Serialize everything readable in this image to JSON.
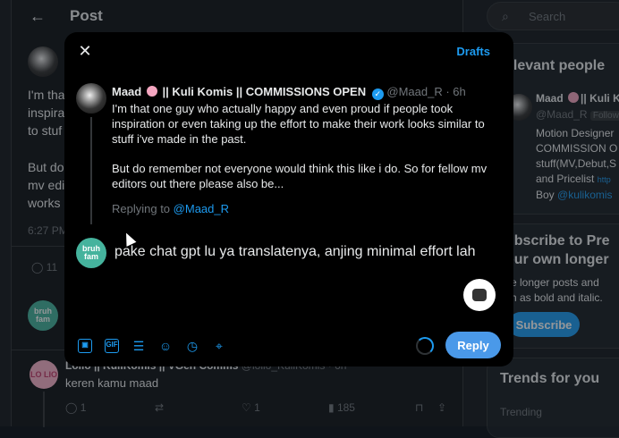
{
  "header": {
    "title": "Post"
  },
  "background_post": {
    "text_lines": [
      "I'm tha",
      "inspira",
      "to stuf",
      "",
      "But do",
      "mv edi",
      "works"
    ],
    "time": "6:27 PM",
    "reply_count": "11"
  },
  "background_reply": {
    "name": "Lolio || KuliKomis || VGen Comms",
    "handle": "@lolio_KuliKomis",
    "time": "6h",
    "text": "keren kamu maad",
    "replies": "1",
    "likes": "1",
    "views": "185",
    "avatar_text": "LO LIO"
  },
  "right_sidebar": {
    "search_placeholder": "Search",
    "relevant_title": "elevant people",
    "relevant_name": "Maad",
    "relevant_name_suffix": "|| Kuli K",
    "relevant_handle": "@Maad_R",
    "follows_badge": "Follows",
    "relevant_bio": [
      "Motion Designer",
      "COMMISSION O",
      "stuff(MV,Debut,S",
      "and Pricelist"
    ],
    "bio_link": "http",
    "bio_end_prefix": "Boy",
    "bio_mention": "@kulikomis",
    "subscribe_title": [
      "ubscribe to Pre",
      "our own longer"
    ],
    "subscribe_desc": [
      "ite longer posts and",
      "ch as bold and italic."
    ],
    "subscribe_btn": "Subscribe",
    "trends_title": "Trends for you",
    "trending_label": "Trending"
  },
  "modal": {
    "drafts": "Drafts",
    "quoted": {
      "name": "Maad",
      "name_rest": "|| Kuli Komis || COMMISSIONS OPEN",
      "handle": "@Maad_R",
      "time": "· 6h",
      "paragraph1": "I'm that one guy who actually happy and even proud if people took inspiration or even taking up the effort to make their work looks similar to stuff i've made in the past.",
      "paragraph2": "But do remember not everyone would think this like i do.  So for fellow mv editors out there please also be..."
    },
    "replying_prefix": "Replying to",
    "replying_to": "@Maad_R",
    "reply_text": "pake chat gpt lu ya translatenya, anjing minimal effort lah",
    "reply_avatar_text": "bruh fam",
    "reply_button": "Reply"
  },
  "colors": {
    "accent": "#1d9bf0",
    "reply_button": "#4a99e9",
    "background": "#000000"
  }
}
